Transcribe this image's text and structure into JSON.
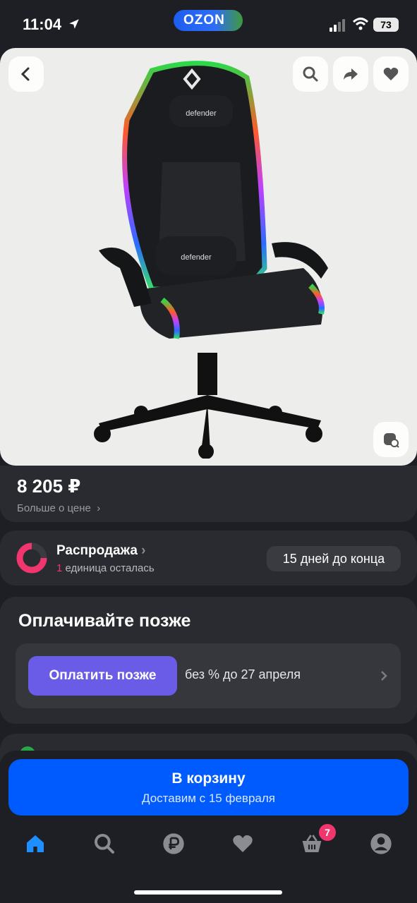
{
  "status_bar": {
    "time": "11:04",
    "app_badge": "OZON",
    "battery": "73"
  },
  "hero": {
    "buttons": [
      "back",
      "search",
      "share",
      "favorite",
      "similar-search"
    ]
  },
  "price": {
    "value": "8 205 ₽",
    "more": "Больше о цене"
  },
  "sale": {
    "title": "Распродажа",
    "count": "1",
    "remaining": "единица осталась",
    "deadline": "15 дней до конца"
  },
  "pay_later": {
    "title": "Оплачивайте позже",
    "button": "Оплатить позже",
    "note": "без % до 27 апреля"
  },
  "cart": {
    "title": "В корзину",
    "subtitle": "Доставим с 15 февраля"
  },
  "nav": {
    "items": [
      "home-icon",
      "search-icon",
      "ruble-icon",
      "heart-icon",
      "basket-icon",
      "profile-icon"
    ],
    "cart_badge": "7"
  },
  "colors": {
    "accent": "#005bff",
    "pay_button": "#6b5ce7",
    "badge": "#f0356f",
    "background": "#1e1f24"
  }
}
